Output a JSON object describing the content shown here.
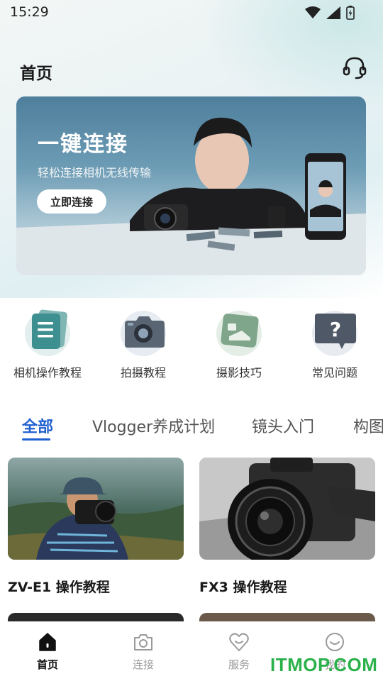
{
  "status_bar": {
    "time": "15:29"
  },
  "header": {
    "title": "首页",
    "support_icon": "headset-icon"
  },
  "banner": {
    "title": "一键连接",
    "subtitle": "轻松连接相机无线传输",
    "button_label": "立即连接"
  },
  "features": [
    {
      "label": "相机操作教程",
      "icon": "document-icon"
    },
    {
      "label": "拍摄教程",
      "icon": "camera-icon"
    },
    {
      "label": "摄影技巧",
      "icon": "photo-icon"
    },
    {
      "label": "常见问题",
      "icon": "question-icon"
    }
  ],
  "tabs": [
    "全部",
    "Vlogger养成计划",
    "镜头入门",
    "构图"
  ],
  "active_tab": "全部",
  "cards": [
    {
      "title": "ZV-E1 操作教程"
    },
    {
      "title": "FX3 操作教程"
    }
  ],
  "bottom_nav": [
    {
      "label": "首页",
      "icon": "home-icon",
      "active": true
    },
    {
      "label": "连接",
      "icon": "camera-connect-icon",
      "active": false
    },
    {
      "label": "服务",
      "icon": "heart-icon",
      "active": false
    },
    {
      "label": "我的",
      "icon": "smile-icon",
      "active": false
    }
  ],
  "watermark": "ITMOP.COM",
  "colors": {
    "accent": "#1f5fd1",
    "watermark": "#2bb14a"
  }
}
